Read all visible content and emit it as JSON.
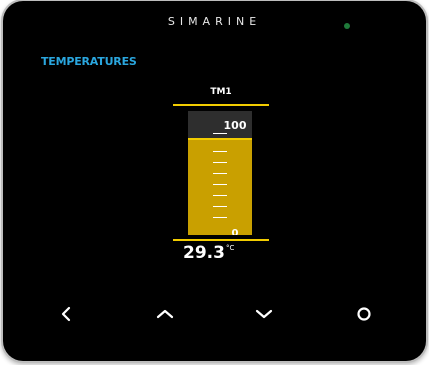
{
  "device": {
    "brand": "SIMARINE",
    "led_color": "#1f7a3a"
  },
  "screen": {
    "title": "TEMPERATURES",
    "title_color": "#2aa6de",
    "sensor": {
      "name": "TM1",
      "scale_max": "100",
      "scale_min": "0",
      "reading": "29.3",
      "unit": "°C",
      "level_fraction": 0.78,
      "fill_color": "#c9a000",
      "accent_color": "#f2cc00"
    }
  },
  "buttons": [
    {
      "name": "back-button",
      "icon": "chevron-left-icon"
    },
    {
      "name": "up-button",
      "icon": "chevron-up-icon"
    },
    {
      "name": "down-button",
      "icon": "chevron-down-icon"
    },
    {
      "name": "home-button",
      "icon": "circle-icon"
    }
  ]
}
